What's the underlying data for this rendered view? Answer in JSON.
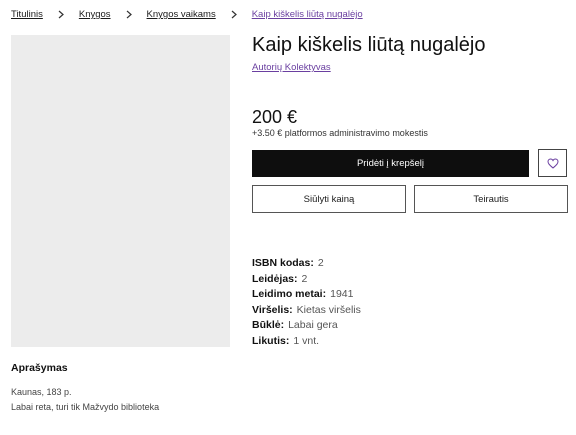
{
  "breadcrumb": {
    "items": [
      "Titulinis",
      "Knygos",
      "Knygos vaikams",
      "Kaip kiškelis liūtą nugalėjo"
    ]
  },
  "product": {
    "title": "Kaip kiškelis liūtą nugalėjo",
    "author": "Autorių Kolektyvas",
    "price": "200 €",
    "fee_note": "+3.50 € platformos administravimo mokestis"
  },
  "actions": {
    "add_to_cart": "Pridėti į krepšelį",
    "offer_price": "Siūlyti kainą",
    "inquire": "Teirautis",
    "favorite_icon": "heart-icon"
  },
  "specs": [
    {
      "label": "ISBN kodas:",
      "value": "2"
    },
    {
      "label": "Leidėjas:",
      "value": "2"
    },
    {
      "label": "Leidimo metai:",
      "value": "1941"
    },
    {
      "label": "Viršelis:",
      "value": "Kietas viršelis"
    },
    {
      "label": "Būklė:",
      "value": "Labai gera"
    },
    {
      "label": "Likutis:",
      "value": "1 vnt."
    }
  ],
  "description": {
    "heading": "Aprašymas",
    "lines": [
      "Kaunas, 183 p.",
      "Labai reta, turi tik Mažvydo biblioteka"
    ]
  },
  "colors": {
    "accent": "#6a3fa0",
    "primary_button": "#0e0e0e",
    "image_placeholder": "#ececec"
  }
}
